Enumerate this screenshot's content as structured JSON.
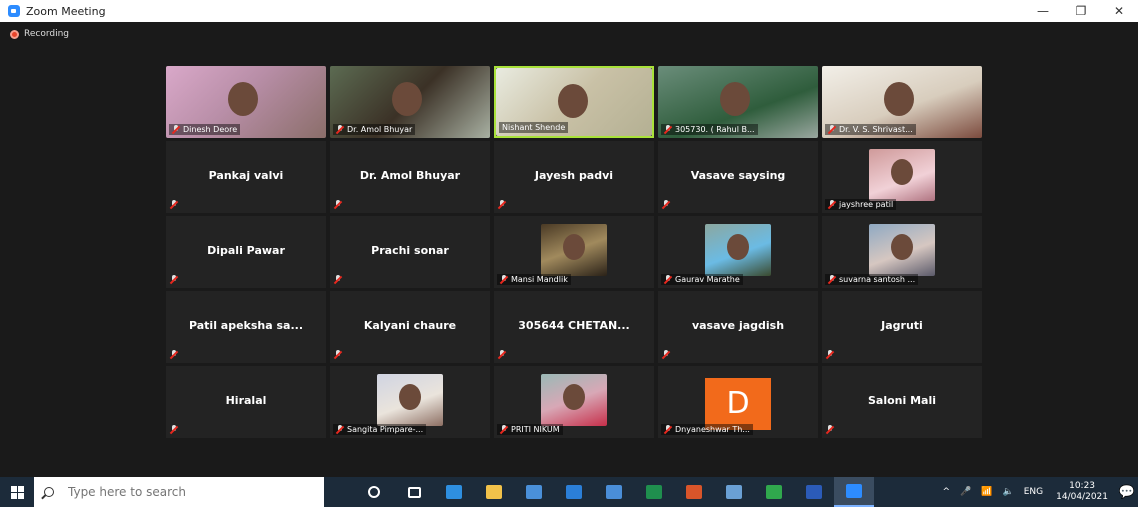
{
  "window": {
    "title": "Zoom Meeting",
    "minimize": "—",
    "restore": "❐",
    "close": "✕"
  },
  "recording": {
    "label": "Recording"
  },
  "tiles": [
    {
      "name": "Dinesh Deore",
      "video": "ph1"
    },
    {
      "name": "Dr. Amol Bhuyar",
      "video": "ph2"
    },
    {
      "name": "Nishant Shende",
      "video": "ph3",
      "active": true,
      "muted": false
    },
    {
      "name": "305730. ( Rahul B...",
      "video": "ph4"
    },
    {
      "name": "Dr. V. S. Shrivast...",
      "video": "ph5"
    },
    {
      "display": "Pankaj valvi"
    },
    {
      "display": "Dr. Amol Bhuyar"
    },
    {
      "display": "Jayesh  padvi"
    },
    {
      "display": "Vasave saysing"
    },
    {
      "name": "jayshree patil",
      "video": "ph6"
    },
    {
      "display": "Dipali Pawar"
    },
    {
      "display": "Prachi sonar"
    },
    {
      "name": "Mansi Mandlik",
      "video": "ph7"
    },
    {
      "name": "Gaurav Marathe",
      "video": "ph8"
    },
    {
      "name": "suvarna santosh ...",
      "video": "ph9"
    },
    {
      "display": "Patil apeksha sa..."
    },
    {
      "display": "Kalyani chaure"
    },
    {
      "display": "305644 CHETAN..."
    },
    {
      "display": "vasave jagdish"
    },
    {
      "display": "Jagruti"
    },
    {
      "display": "Hiralal"
    },
    {
      "name": "Sangita Pimpare-...",
      "video": "ph10"
    },
    {
      "name": "PRITI NIKUM",
      "video": "ph11"
    },
    {
      "name": "Dnyaneshwar Th...",
      "avatar": "D"
    },
    {
      "display": "Saloni Mali"
    }
  ],
  "taskbar": {
    "search_placeholder": "Type here to search",
    "lang": "ENG",
    "time": "10:23",
    "date": "14/04/2021",
    "tray_chevron": "^",
    "notifications_icon": "💬",
    "apps": [
      {
        "icon": "cortana-icon",
        "color": "#ffffff"
      },
      {
        "icon": "task-view-icon",
        "color": "#ffffff"
      },
      {
        "icon": "edge-icon",
        "color": "#2e8fe0"
      },
      {
        "icon": "file-explorer-icon",
        "color": "#f2c24a"
      },
      {
        "icon": "store-icon",
        "color": "#4a90d9"
      },
      {
        "icon": "mail-icon",
        "color": "#2b7fd8"
      },
      {
        "icon": "photos-icon",
        "color": "#4a8ed8"
      },
      {
        "icon": "excel-icon",
        "color": "#1f8f4e"
      },
      {
        "icon": "powerpoint-icon",
        "color": "#d9552a"
      },
      {
        "icon": "app-icon",
        "color": "#6aa0d4"
      },
      {
        "icon": "chrome-icon",
        "color": "#30a84d"
      },
      {
        "icon": "word-icon",
        "color": "#2b5bb8"
      },
      {
        "icon": "zoom-icon",
        "color": "#2d8cff",
        "active": true
      }
    ]
  }
}
